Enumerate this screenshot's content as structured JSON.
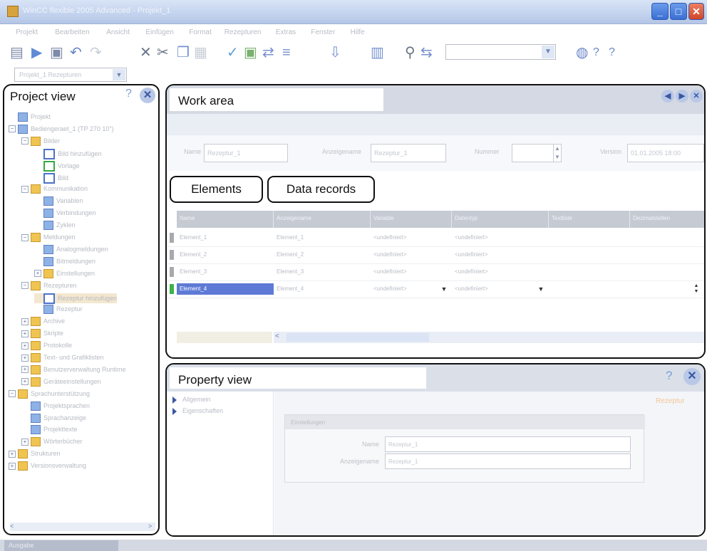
{
  "window": {
    "title": "WinCC flexible 2005 Advanced - Projekt_1",
    "minimize_label": "_",
    "maximize_label": "□",
    "close_label": "✕"
  },
  "menu": [
    "Projekt",
    "Bearbeiten",
    "Ansicht",
    "Einfügen",
    "Format",
    "Rezepturen",
    "Extras",
    "Fenster",
    "Hilfe"
  ],
  "toolbar": {
    "buttons": [
      "new",
      "open",
      "save",
      "undo",
      "redo",
      "delete",
      "cut",
      "copy",
      "paste",
      "check",
      "compile",
      "transfer",
      "language",
      "download",
      "print",
      "find",
      "replace",
      "help",
      "whats-this"
    ],
    "combo_value": "",
    "combo_arrow": "▼"
  },
  "scope_combo": {
    "value": "Projekt_1 Rezepturen",
    "arrow": "▼"
  },
  "project_view": {
    "title": "Project view",
    "help_icon": "?",
    "close_label": "✕",
    "tree": [
      {
        "label": "Projekt",
        "level": 0,
        "exp": "",
        "icon": "doc"
      },
      {
        "label": "Bediengeraet_1 (TP 270 10\")",
        "level": 0,
        "exp": "−",
        "icon": "doc"
      },
      {
        "label": "Bilder",
        "level": 1,
        "exp": "−",
        "icon": "folder"
      },
      {
        "label": "Bild hinzufügen",
        "level": 2,
        "exp": "",
        "icon": "blue"
      },
      {
        "label": "Vorlage",
        "level": 2,
        "exp": "",
        "icon": "green"
      },
      {
        "label": "Bild",
        "level": 2,
        "exp": "",
        "icon": "blue"
      },
      {
        "label": "Kommunikation",
        "level": 1,
        "exp": "−",
        "icon": "folder"
      },
      {
        "label": "Variablen",
        "level": 2,
        "exp": "",
        "icon": "doc"
      },
      {
        "label": "Verbindungen",
        "level": 2,
        "exp": "",
        "icon": "doc"
      },
      {
        "label": "Zyklen",
        "level": 2,
        "exp": "",
        "icon": "doc"
      },
      {
        "label": "Meldungen",
        "level": 1,
        "exp": "−",
        "icon": "folder"
      },
      {
        "label": "Analogmeldungen",
        "level": 2,
        "exp": "",
        "icon": "doc"
      },
      {
        "label": "Bitmeldungen",
        "level": 2,
        "exp": "",
        "icon": "doc"
      },
      {
        "label": "Einstellungen",
        "level": 2,
        "exp": "+",
        "icon": "folder"
      },
      {
        "label": "Rezepturen",
        "level": 1,
        "exp": "−",
        "icon": "folder"
      },
      {
        "label": "Rezeptur hinzufügen",
        "level": 2,
        "exp": "",
        "icon": "blue",
        "selected": true
      },
      {
        "label": "Rezeptur",
        "level": 2,
        "exp": "",
        "icon": "doc"
      },
      {
        "label": "Archive",
        "level": 1,
        "exp": "+",
        "icon": "folder"
      },
      {
        "label": "Skripte",
        "level": 1,
        "exp": "+",
        "icon": "folder"
      },
      {
        "label": "Protokolle",
        "level": 1,
        "exp": "+",
        "icon": "folder"
      },
      {
        "label": "Text- und Grafiklisten",
        "level": 1,
        "exp": "+",
        "icon": "folder"
      },
      {
        "label": "Benutzerverwaltung Runtime",
        "level": 1,
        "exp": "+",
        "icon": "folder"
      },
      {
        "label": "Geräteeinstellungen",
        "level": 1,
        "exp": "+",
        "icon": "folder"
      },
      {
        "label": "Sprachunterstützung",
        "level": 0,
        "exp": "−",
        "icon": "folder"
      },
      {
        "label": "Projektsprachen",
        "level": 1,
        "exp": "",
        "icon": "doc"
      },
      {
        "label": "Sprachanzeige",
        "level": 1,
        "exp": "",
        "icon": "doc"
      },
      {
        "label": "Projekttexte",
        "level": 1,
        "exp": "",
        "icon": "doc"
      },
      {
        "label": "Wörterbücher",
        "level": 1,
        "exp": "+",
        "icon": "folder"
      },
      {
        "label": "Strukturen",
        "level": 0,
        "exp": "+",
        "icon": "folder"
      },
      {
        "label": "Versionsverwaltung",
        "level": 0,
        "exp": "+",
        "icon": "folder"
      }
    ],
    "scroll_left": "<",
    "scroll_right": ">"
  },
  "work_area": {
    "title": "Work area",
    "nav_prev": "◀",
    "nav_next": "▶",
    "close_label": "✕",
    "form": {
      "name_label": "Name",
      "name_value": "Rezeptur_1",
      "display_label": "Anzeigename",
      "display_value": "Rezeptur_1",
      "number_label": "Nummer",
      "number_value": "",
      "version_label": "Version",
      "version_value": "01.01.2005 18:00",
      "spin_up": "▲",
      "spin_down": "▼"
    },
    "tabs": {
      "elements": "Elements",
      "data_records": "Data records"
    },
    "columns": [
      "Name",
      "Anzeigename",
      "Variable",
      "Datentyp",
      "Textliste",
      "Dezimalstellen"
    ],
    "rows": [
      [
        "Element_1",
        "Element_1",
        "<undefiniert>",
        "<undefiniert>",
        "",
        ""
      ],
      [
        "Element_2",
        "Element_2",
        "<undefiniert>",
        "<undefiniert>",
        "",
        ""
      ],
      [
        "Element_3",
        "Element_3",
        "<undefiniert>",
        "<undefiniert>",
        "",
        ""
      ],
      [
        "Element_4",
        "Element_4",
        "<undefiniert>",
        "<undefiniert>",
        "",
        ""
      ]
    ],
    "dropdown_arrow": "▼",
    "scroll_left": "<"
  },
  "property_view": {
    "title": "Property view",
    "help_icon": "?",
    "close_label": "✕",
    "nav": [
      "Allgemein",
      "Eigenschaften"
    ],
    "badge": "Rezeptur",
    "group_title": "Einstellungen",
    "fields": [
      {
        "label": "Name",
        "value": "Rezeptur_1"
      },
      {
        "label": "Anzeigename",
        "value": "Rezeptur_1"
      }
    ]
  },
  "bottom": {
    "tab": "Ausgabe"
  }
}
